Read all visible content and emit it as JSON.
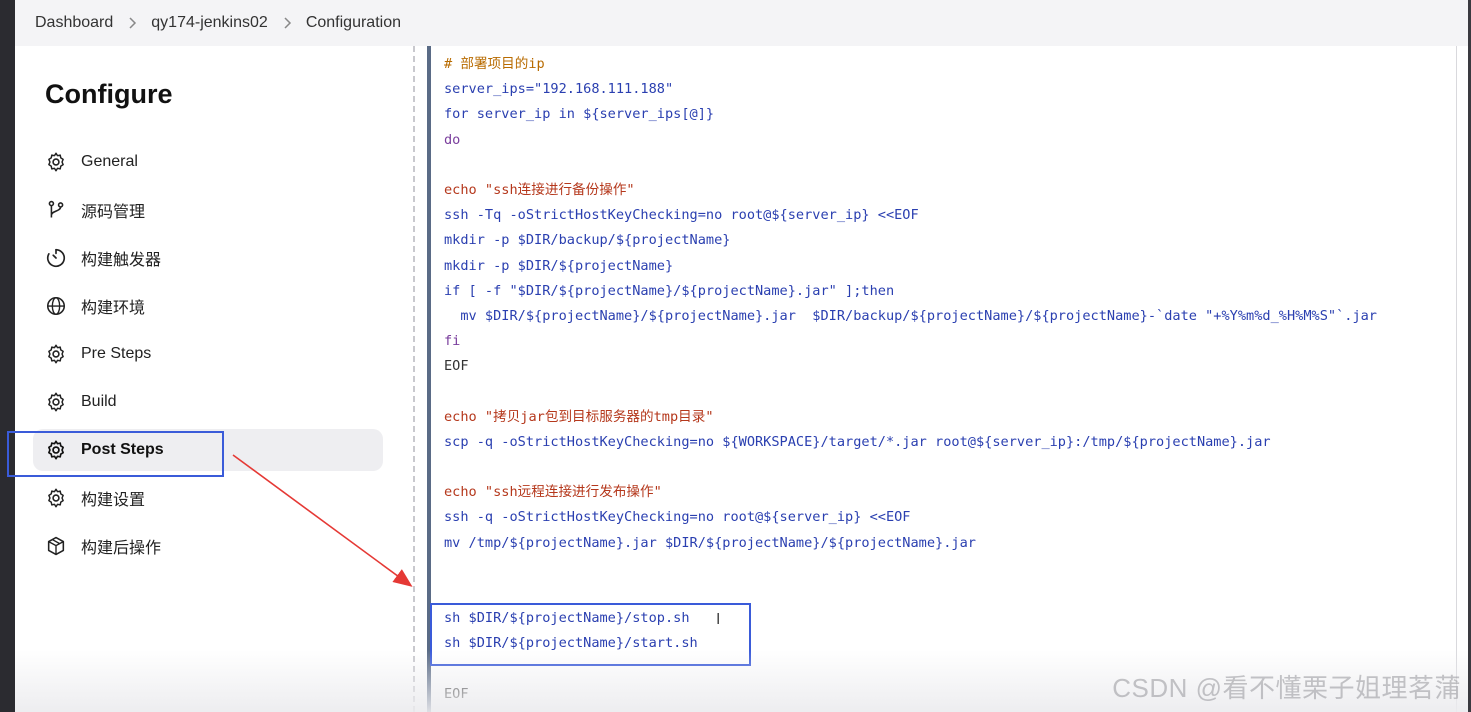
{
  "breadcrumb": {
    "items": [
      "Dashboard",
      "qy174-jenkins02",
      "Configuration"
    ]
  },
  "sidebar": {
    "title": "Configure",
    "items": [
      {
        "label": "General",
        "icon": "gear-icon"
      },
      {
        "label": "源码管理",
        "icon": "branch-icon"
      },
      {
        "label": "构建触发器",
        "icon": "timer-icon"
      },
      {
        "label": "构建环境",
        "icon": "globe-icon"
      },
      {
        "label": "Pre Steps",
        "icon": "gear-icon"
      },
      {
        "label": "Build",
        "icon": "gear-icon"
      },
      {
        "label": "Post Steps",
        "icon": "gear-icon",
        "active": true
      },
      {
        "label": "构建设置",
        "icon": "gear-icon"
      },
      {
        "label": "构建后操作",
        "icon": "package-icon"
      }
    ]
  },
  "editor": {
    "lines": [
      "# 部署项目的ip",
      "server_ips=\"192.168.111.188\"",
      "for server_ip in ${server_ips[@]}",
      "do",
      "",
      "echo \"ssh连接进行备份操作\"",
      "ssh -Tq -oStrictHostKeyChecking=no root@${server_ip} <<EOF",
      "mkdir -p $DIR/backup/${projectName}",
      "mkdir -p $DIR/${projectName}",
      "if [ -f \"$DIR/${projectName}/${projectName}.jar\" ];then",
      "  mv $DIR/${projectName}/${projectName}.jar  $DIR/backup/${projectName}/${projectName}-`date \"+%Y%m%d_%H%M%S\"`.jar",
      "fi",
      "EOF",
      "",
      "echo \"拷贝jar包到目标服务器的tmp目录\"",
      "scp -q -oStrictHostKeyChecking=no ${WORKSPACE}/target/*.jar root@${server_ip}:/tmp/${projectName}.jar",
      "",
      "echo \"ssh远程连接进行发布操作\"",
      "ssh -q -oStrictHostKeyChecking=no root@${server_ip} <<EOF",
      "mv /tmp/${projectName}.jar $DIR/${projectName}/${projectName}.jar",
      "",
      "",
      "sh $DIR/${projectName}/stop.sh",
      "sh $DIR/${projectName}/start.sh",
      "",
      "EOF"
    ]
  },
  "watermark": "CSDN @看不懂栗子姐理茗蒲",
  "colors": {
    "highlight_box": "#3a5bd9",
    "arrow": "#e53935",
    "active_nav_bg": "#eeeef1"
  }
}
